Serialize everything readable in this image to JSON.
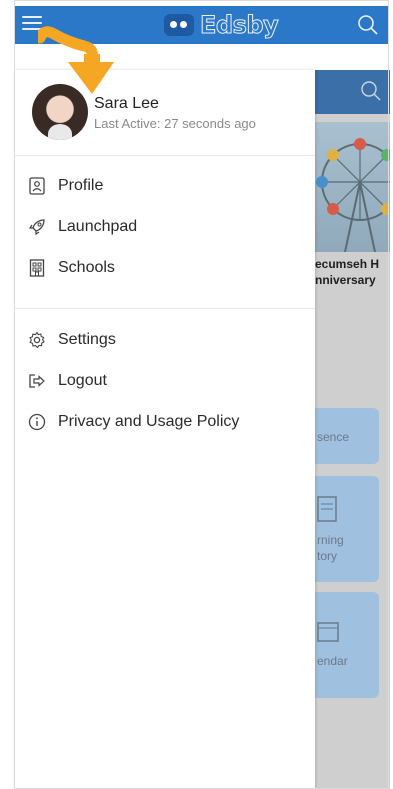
{
  "header": {
    "brand": "Edsby",
    "menu_icon": "hamburger-menu-icon",
    "search_icon": "search-icon"
  },
  "drawer": {
    "user": {
      "name": "Sara Lee",
      "status": "Last Active: 27 seconds ago"
    },
    "items_primary": [
      {
        "label": "Profile",
        "icon": "profile-card-icon"
      },
      {
        "label": "Launchpad",
        "icon": "rocket-icon"
      },
      {
        "label": "Schools",
        "icon": "building-icon"
      }
    ],
    "items_secondary": [
      {
        "label": "Settings",
        "icon": "gear-icon"
      },
      {
        "label": "Logout",
        "icon": "logout-icon"
      },
      {
        "label": "Privacy and Usage Policy",
        "icon": "info-icon"
      }
    ]
  },
  "background": {
    "caption_line1": "ecumseh H",
    "caption_line2": "nniversary",
    "cards": [
      "sence",
      "rning\ntory",
      "endar"
    ]
  },
  "colors": {
    "accent": "#2b78c8",
    "pointer": "#f5a623"
  }
}
